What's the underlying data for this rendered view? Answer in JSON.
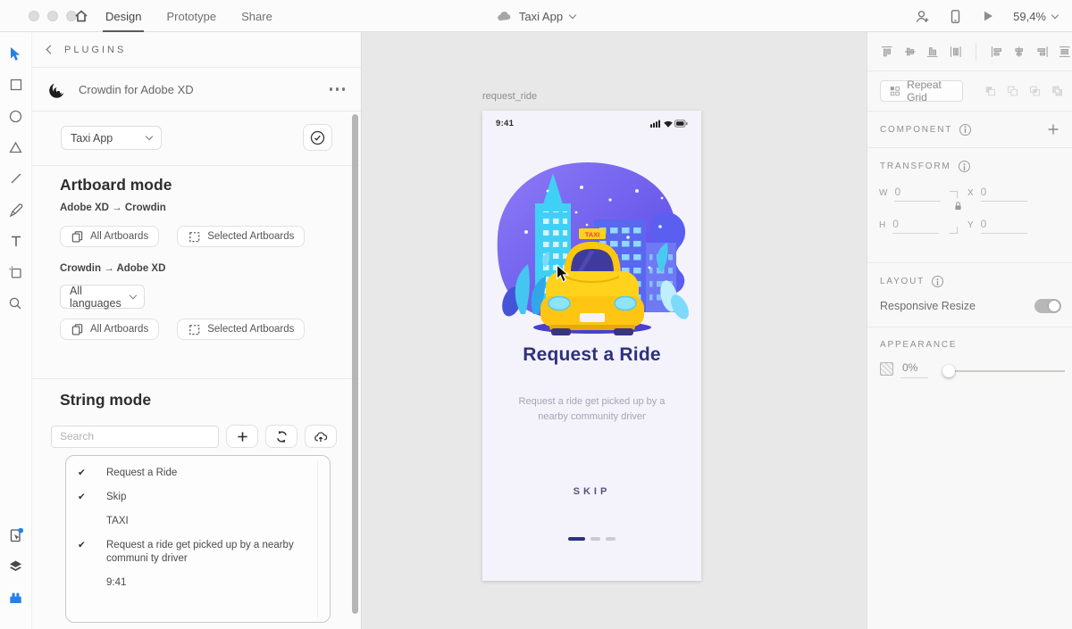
{
  "colors": {
    "accent_blue": "#2680eb",
    "title_indigo": "#2e3180",
    "taxi_yellow": "#ffd21c",
    "artboard_bg": "#f4f3fb"
  },
  "topbar": {
    "tabs": [
      "Design",
      "Prototype",
      "Share"
    ],
    "active_tab": "Design",
    "document_title": "Taxi App",
    "zoom_level": "59,4%"
  },
  "plugin_panel": {
    "header": "PLUGINS",
    "plugin_name": "Crowdin for Adobe XD",
    "project_select_value": "Taxi App",
    "artboard_mode": {
      "heading": "Artboard mode",
      "xd_to_crowdin": "Adobe XD → Crowdin",
      "crowdin_to_xd": "Crowdin → Adobe XD",
      "all_artboards_label": "All Artboards",
      "selected_artboards_label": "Selected Artboards",
      "languages_value": "All languages"
    },
    "string_mode": {
      "heading": "String mode",
      "search_placeholder": "Search",
      "strings": [
        {
          "check": "✔",
          "text": "Request a Ride"
        },
        {
          "check": "✔",
          "text": "Skip"
        },
        {
          "check": "",
          "text": "TAXI"
        },
        {
          "check": "✔",
          "text": "Request a ride get picked up by a nearby communi ty driver"
        },
        {
          "check": "",
          "text": "9:41"
        }
      ]
    }
  },
  "canvas": {
    "artboard_name": "request_ride",
    "phone": {
      "status_time": "9:41",
      "taxi_sign": "TAXI",
      "title": "Request a Ride",
      "subtitle_line1": "Request a ride get picked up by a",
      "subtitle_line2": "nearby community driver",
      "skip_label": "SKIP"
    }
  },
  "right_panel": {
    "repeat_grid_label": "Repeat Grid",
    "component_label": "COMPONENT",
    "transform": {
      "heading": "TRANSFORM",
      "w_label": "W",
      "w": "0",
      "h_label": "H",
      "h": "0",
      "x_label": "X",
      "x": "0",
      "y_label": "Y",
      "y": "0"
    },
    "layout": {
      "heading": "LAYOUT",
      "responsive_resize": "Responsive Resize"
    },
    "appearance": {
      "heading": "APPEARANCE",
      "opacity": "0%"
    }
  }
}
